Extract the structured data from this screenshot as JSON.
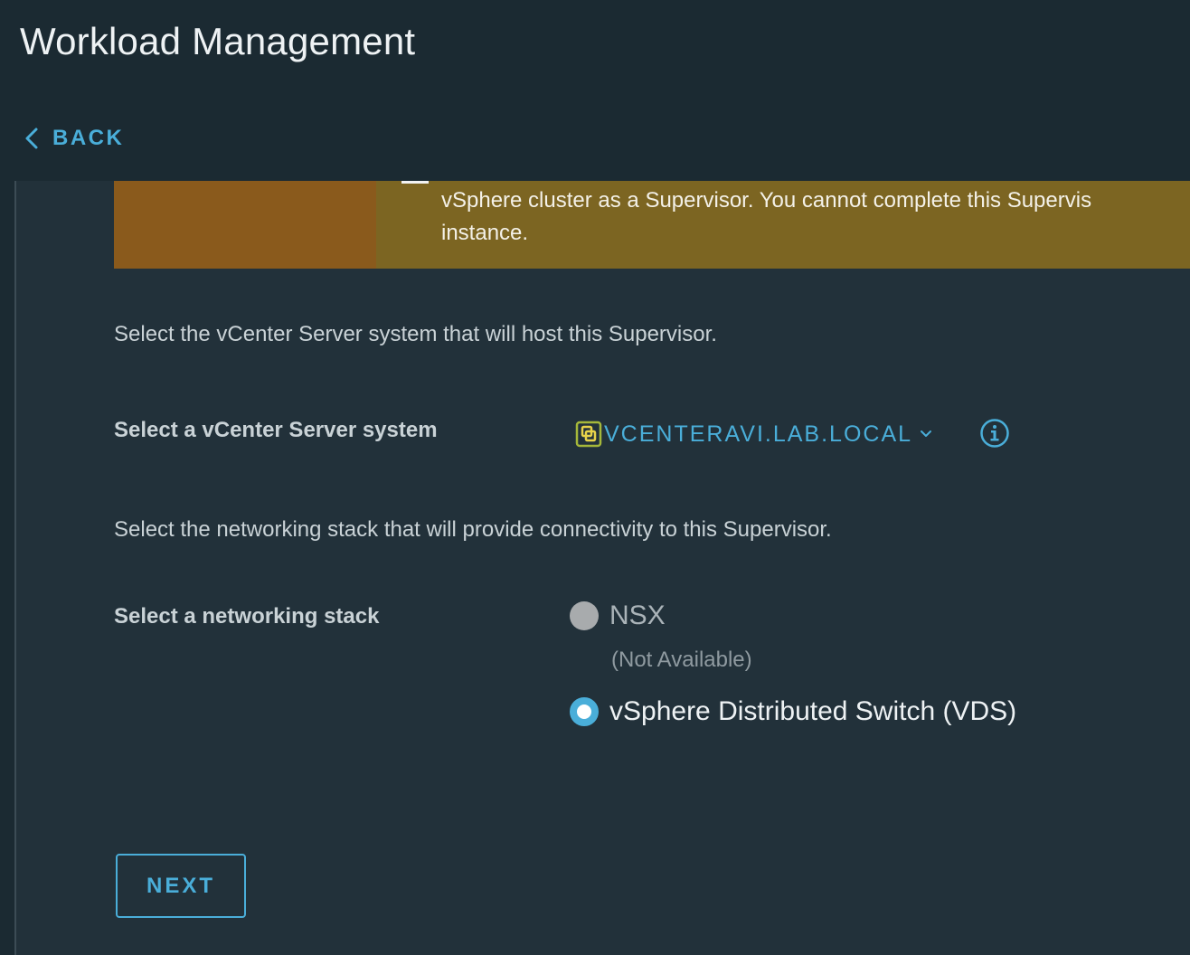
{
  "header": {
    "title": "Workload Management",
    "back_label": "BACK"
  },
  "banner": {
    "line1": "vSphere cluster as a Supervisor. You cannot complete this Supervis",
    "line2": "instance."
  },
  "vcenter_section": {
    "description": "Select the vCenter Server system that will host this Supervisor.",
    "field_label": "Select a vCenter Server system",
    "selected_value": "VCENTERAVI.LAB.LOCAL"
  },
  "network_section": {
    "description": "Select the networking stack that will provide connectivity to this Supervisor.",
    "field_label": "Select a networking stack",
    "options": [
      {
        "label": "NSX",
        "note": "(Not Available)",
        "state": "disabled"
      },
      {
        "label": "vSphere Distributed Switch (VDS)",
        "state": "selected"
      }
    ]
  },
  "actions": {
    "next_label": "NEXT"
  },
  "colors": {
    "accent": "#4aaed9",
    "background": "#1b2a32",
    "panel": "#22313a",
    "warning_banner": "#7c6522"
  },
  "icons": {
    "back": "chevron-left-icon",
    "vcenter": "vcenter-icon",
    "dropdown": "chevron-down-icon",
    "info": "info-circle-icon"
  }
}
